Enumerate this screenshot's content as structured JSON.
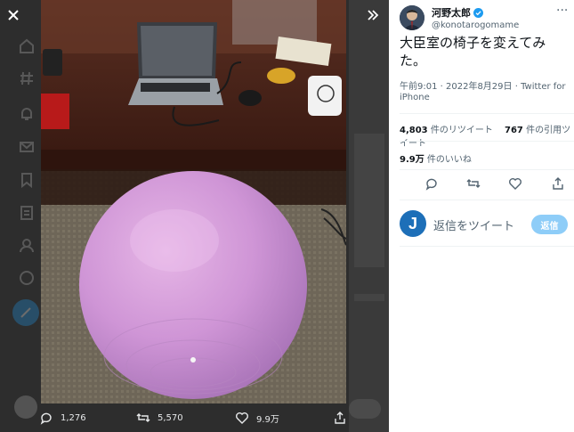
{
  "media_viewer": {
    "close_icon": "close-icon",
    "collapse_icon": "double-chevron-right-icon",
    "photo_alt": "",
    "actions": {
      "reply_count": "1,276",
      "retweet_count": "5,570",
      "like_count": "9.9万"
    }
  },
  "tweet": {
    "author_name": "河野太郎",
    "author_handle": "@konotarogomame",
    "verified": true,
    "text": "大臣室の椅子を変えてみた。",
    "meta": "午前9:01 · 2022年8月29日 · Twitter for iPhone",
    "stats": {
      "retweets_value": "4,803",
      "retweets_label": " 件のリツイート",
      "quotes_value": "767",
      "quotes_label": " 件の引用ツイート",
      "likes_value": "9.9万",
      "likes_label": " 件のいいね"
    }
  },
  "reply_box": {
    "avatar_letter": "J",
    "placeholder": "返信をツイート",
    "button_label": "返信"
  },
  "colors": {
    "accent": "#1d9bf0",
    "reply_button_disabled": "#8ecdf8",
    "viewer_bg": "#2b2b2b"
  }
}
